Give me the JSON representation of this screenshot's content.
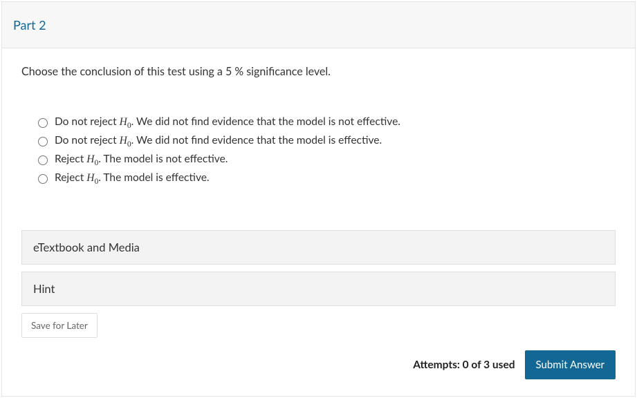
{
  "part": {
    "title": "Part 2"
  },
  "question": {
    "prefix": "Choose the conclusion of this test using a ",
    "sig_value": "5",
    "sig_unit": " %",
    "suffix": "  significance level."
  },
  "options": [
    {
      "pre": "Do not reject ",
      "post": ". We did not find evidence that the model is not effective."
    },
    {
      "pre": "Do not reject ",
      "post": ". We did not find evidence that the model is effective."
    },
    {
      "pre": "Reject ",
      "post": ". The model is not effective."
    },
    {
      "pre": "Reject ",
      "post": ". The model is effective."
    }
  ],
  "hypothesis": {
    "symbol": "H",
    "sub": "0"
  },
  "panels": {
    "etextbook": "eTextbook and Media",
    "hint": "Hint"
  },
  "buttons": {
    "save": "Save for Later",
    "submit": "Submit Answer"
  },
  "attempts": {
    "text": "Attempts: 0 of 3 used"
  }
}
